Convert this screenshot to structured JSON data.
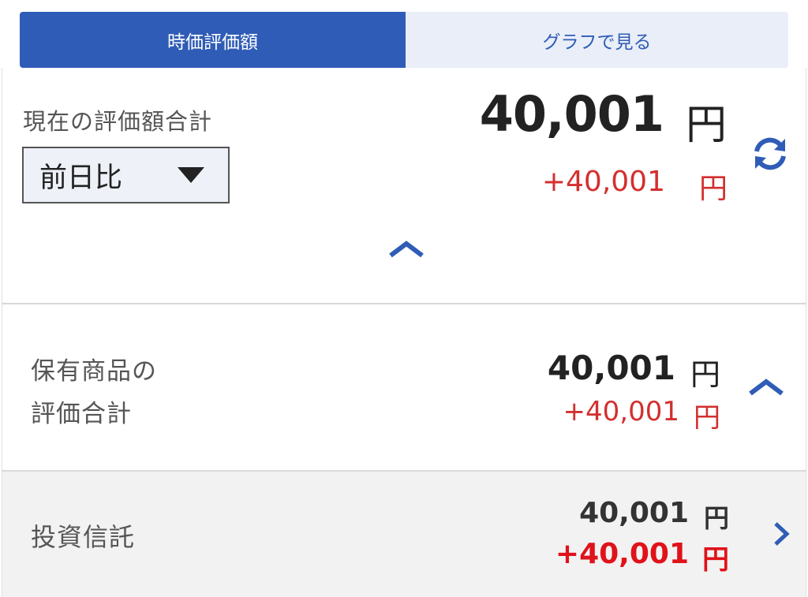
{
  "tabs": {
    "active_label": "時価評価額",
    "inactive_label": "グラフで見る"
  },
  "summary": {
    "label": "現在の評価額合計",
    "period_select": "前日比",
    "total_value": "40,001",
    "total_unit": "円",
    "change_value": "+40,001",
    "change_unit": "円"
  },
  "holdings": {
    "label_line1": "保有商品の",
    "label_line2": "評価合計",
    "value": "40,001",
    "unit": "円",
    "change_value": "+40,001",
    "change_unit": "円"
  },
  "fund": {
    "label": "投資信託",
    "value": "40,001",
    "unit": "円",
    "change_value": "+40,001",
    "change_unit": "円"
  },
  "icons": {
    "refresh": "refresh-icon",
    "collapse": "chevron-up-icon",
    "navigate": "chevron-right-icon"
  },
  "colors": {
    "accent": "#2f5cb6",
    "tab_inactive_bg": "#e9eef8",
    "positive_change": "#d32f2f",
    "positive_change_strong": "#e0121a"
  }
}
